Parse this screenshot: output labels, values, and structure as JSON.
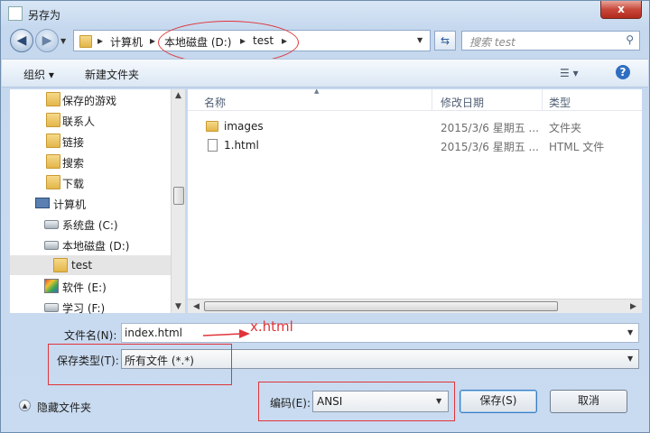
{
  "window": {
    "title": "另存为",
    "close_glyph": "x"
  },
  "nav": {
    "back_glyph": "◀",
    "forward_glyph": "▶",
    "refresh_glyph": "⇆"
  },
  "address": {
    "segments": [
      "计算机",
      "本地磁盘 (D:)",
      "test"
    ],
    "separator": "▸"
  },
  "search": {
    "placeholder": "搜索 test"
  },
  "toolbar": {
    "organize_label": "组织 ▾",
    "new_folder_label": "新建文件夹",
    "view_glyph": "☰ ▾",
    "help_glyph": "?"
  },
  "sidebar": {
    "items": [
      {
        "label": "保存的游戏"
      },
      {
        "label": "联系人"
      },
      {
        "label": "链接"
      },
      {
        "label": "搜索"
      },
      {
        "label": "下载"
      },
      {
        "label": "计算机"
      },
      {
        "label": "系统盘 (C:)"
      },
      {
        "label": "本地磁盘 (D:)"
      },
      {
        "label": "test"
      },
      {
        "label": "软件 (E:)"
      },
      {
        "label": "学习 (F:)"
      }
    ]
  },
  "files": {
    "columns": [
      "名称",
      "修改日期",
      "类型"
    ],
    "rows": [
      {
        "name": "images",
        "date": "2015/3/6 星期五 ...",
        "type": "文件夹"
      },
      {
        "name": "1.html",
        "date": "2015/3/6 星期五 ...",
        "type": "HTML 文件"
      }
    ]
  },
  "form": {
    "filename_label": "文件名(N):",
    "filename_value": "index.html",
    "filetype_label": "保存类型(T):",
    "filetype_value": "所有文件  (*.*)",
    "encoding_label": "编码(E):",
    "encoding_value": "ANSI",
    "save_label": "保存(S)",
    "cancel_label": "取消",
    "hide_folders_label": "隐藏文件夹"
  },
  "annotation": {
    "text": "x.html",
    "color": "#e0353a"
  }
}
